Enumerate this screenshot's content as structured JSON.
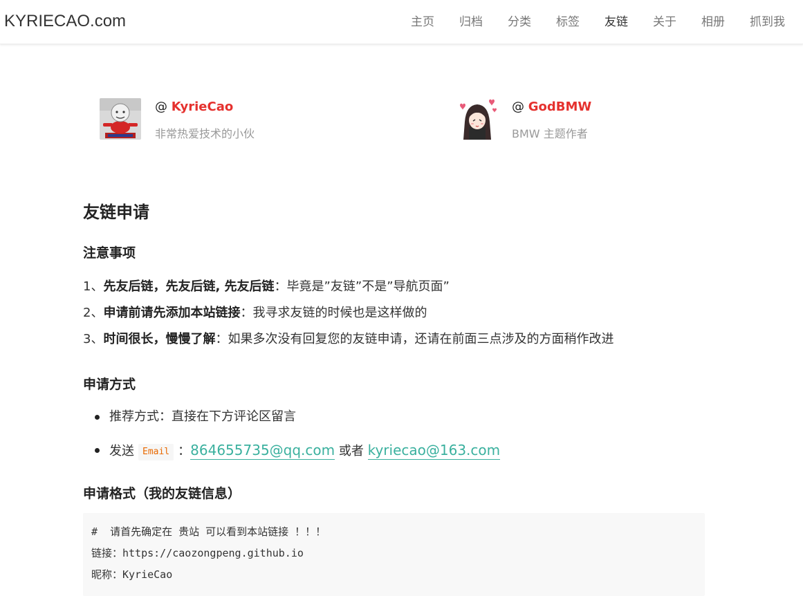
{
  "header": {
    "brand": "KYRIECAO.com",
    "nav": [
      "主页",
      "归档",
      "分类",
      "标签",
      "友链",
      "关于",
      "相册",
      "抓到我"
    ],
    "active": "友链"
  },
  "friends": [
    {
      "at": "@",
      "name": "KyrieCao",
      "desc": "非常热爱技术的小伙"
    },
    {
      "at": "@",
      "name": "GodBMW",
      "desc": "BMW 主题作者"
    }
  ],
  "post": {
    "title": "友链申请",
    "notes_heading": "注意事项",
    "notes": [
      {
        "num": "1、",
        "bold": "先友后链，先友后链, 先友后链",
        "rest": "：毕竟是”友链”不是”导航页面”"
      },
      {
        "num": "2、",
        "bold": "申请前请先添加本站链接",
        "rest": "：我寻求友链的时候也是这样做的"
      },
      {
        "num": "3、",
        "bold": "时间很长，慢慢了解",
        "rest": "：如果多次没有回复您的友链申请，还请在前面三点涉及的方面稍作改进"
      }
    ],
    "apply_heading": "申请方式",
    "apply_item1": "推荐方式：直接在下方评论区留言",
    "apply_item2_prefix": "发送",
    "apply_item2_code": "Email",
    "apply_item2_colon": "：",
    "email1": "864655735@qq.com",
    "or": "或者",
    "email2": "kyriecao@163.com",
    "format_heading": "申请格式（我的友链信息）",
    "code_lines": [
      "#  请首先确定在 贵站 可以看到本站链接 ！！！",
      "链接：https://caozongpeng.github.io",
      "昵称：KyrieCao"
    ]
  },
  "colors": {
    "accent_red": "#e5312e",
    "link_green": "#3ab09e",
    "inline_code": "#e96900"
  }
}
